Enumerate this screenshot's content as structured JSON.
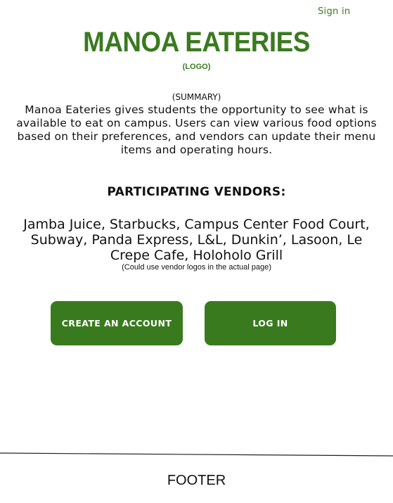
{
  "header": {
    "sign_in": "Sign in",
    "title": "MANOA EATERIES",
    "logo_label": "(LOGO)"
  },
  "summary": {
    "label": "(SUMMARY)",
    "text": "Manoa Eateries gives students the opportunity to see what is available to eat on campus. Users can view various food options based on their preferences, and vendors can update their menu items and operating hours."
  },
  "vendors": {
    "heading": "PARTICIPATING VENDORS:",
    "list": "Jamba Juice, Starbucks, Campus Center Food Court, Subway, Panda Express, L&L, Dunkin’, Lasoon, Le Crepe Cafe, Holoholo Grill",
    "note": "(Could use vendor logos in the actual page)"
  },
  "actions": {
    "create_account": "CREATE AN ACCOUNT",
    "log_in": "LOG IN"
  },
  "footer": {
    "label": "FOOTER"
  },
  "colors": {
    "brand_green": "#3a7a1f",
    "button_text": "#ffffff"
  }
}
